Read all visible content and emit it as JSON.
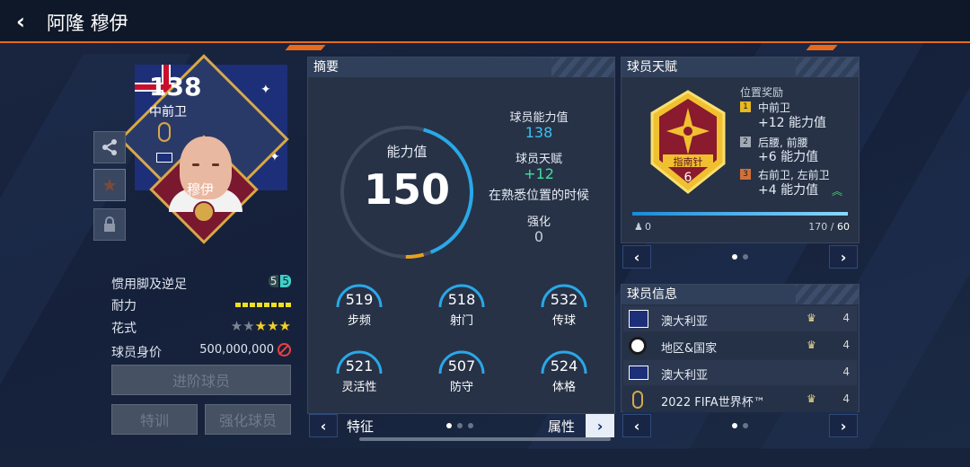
{
  "header": {
    "back_label": "‹",
    "title": "阿隆 穆伊"
  },
  "card": {
    "rating": "138",
    "position": "中前卫",
    "name": "穆伊"
  },
  "side_buttons": [
    {
      "icon": "share-icon"
    },
    {
      "icon": "star-icon"
    },
    {
      "icon": "lock-icon"
    }
  ],
  "attributes": {
    "foot_label": "惯用脚及逆足",
    "foot_values": [
      "5",
      "5"
    ],
    "stamina_label": "耐力",
    "skill_label": "花式",
    "skill_stars": "★★★★★",
    "value_label": "球员身价",
    "value": "500,000,000"
  },
  "buttons": {
    "upgrade": "进阶球员",
    "training": "特训",
    "enhance": "强化球员"
  },
  "summary": {
    "title": "摘要",
    "overall_label": "能力值",
    "overall_value": "150",
    "player_ability_label": "球员能力值",
    "player_ability_value": "138",
    "talent_label": "球员天赋",
    "talent_value": "+12",
    "talent_note": "在熟悉位置的时候",
    "enhance_label": "强化",
    "enhance_value": "0",
    "stats": [
      {
        "value": "519",
        "label": "步频"
      },
      {
        "value": "518",
        "label": "射门"
      },
      {
        "value": "532",
        "label": "传球"
      },
      {
        "value": "521",
        "label": "灵活性"
      },
      {
        "value": "507",
        "label": "防守"
      },
      {
        "value": "524",
        "label": "体格"
      }
    ],
    "footer_left": "特征",
    "footer_right": "属性"
  },
  "talent": {
    "title": "球员天赋",
    "badge_name": "指南针",
    "badge_level": "6",
    "bonus_header": "位置奖励",
    "bonuses": [
      {
        "rank": "1",
        "positions": "中前卫",
        "bonus": "+12 能力值"
      },
      {
        "rank": "2",
        "positions": "后腰, 前腰",
        "bonus": "+6 能力值"
      },
      {
        "rank": "3",
        "positions": "右前卫, 左前卫",
        "bonus": "+4 能力值"
      }
    ],
    "progress_left": "0",
    "progress_current": "170",
    "progress_sep": " / ",
    "progress_max": "60"
  },
  "info": {
    "title": "球员信息",
    "rows": [
      {
        "text": "澳大利亚",
        "level": "4"
      },
      {
        "text": "地区&国家",
        "level": "4"
      },
      {
        "text": "澳大利亚",
        "level": "4"
      },
      {
        "text": "2022 FIFA世界杯™",
        "level": "4"
      }
    ]
  },
  "colors": {
    "accent": "#e86a1c",
    "ring": "#29a8e8",
    "talent_green": "#3fe0a0",
    "ability_blue": "#3bc0f0"
  }
}
